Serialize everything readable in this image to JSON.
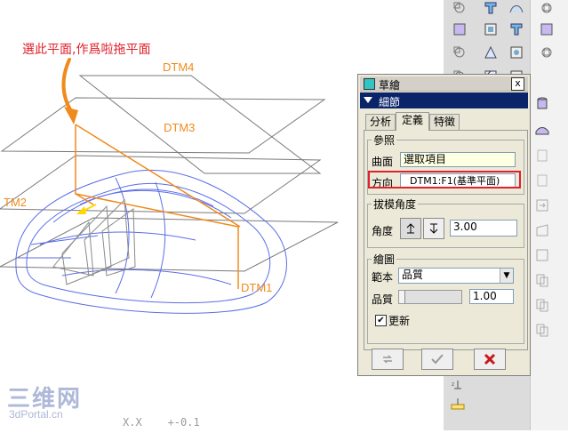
{
  "viewport": {
    "annotation": "選此平面,作爲啦拖平面",
    "datums": {
      "dtm4": "DTM4",
      "dtm3": "DTM3",
      "dtm2": "TM2",
      "dtm1": "DTM1"
    },
    "status_text": "X.X    +-0.1",
    "watermark_cn": "三维网",
    "watermark_url": "3dPortal.cn"
  },
  "dialog": {
    "title": "草繪",
    "close_glyph": "x",
    "details_label": "細節",
    "tabs": [
      "分析",
      "定義",
      "特徵"
    ],
    "active_tab": 1,
    "references": {
      "legend": "參照",
      "surface_label": "曲面",
      "surface_value": "選取項目",
      "direction_label": "方向",
      "direction_value": "DTM1:F1(基準平面)"
    },
    "draft_angle": {
      "legend": "拔模角度",
      "angle_label": "角度",
      "angle_value": "3.00"
    },
    "plot": {
      "legend": "繪圖",
      "template_label": "範本",
      "template_value": "品質",
      "quality_label": "品質",
      "quality_value": "1.00",
      "update_label": "更新",
      "update_checked": true
    }
  },
  "colors": {
    "accent_orange": "#f08a1c",
    "model_blue": "#5a6ee8",
    "title_blue": "#0a246a",
    "highlight_red": "#e0202a"
  }
}
